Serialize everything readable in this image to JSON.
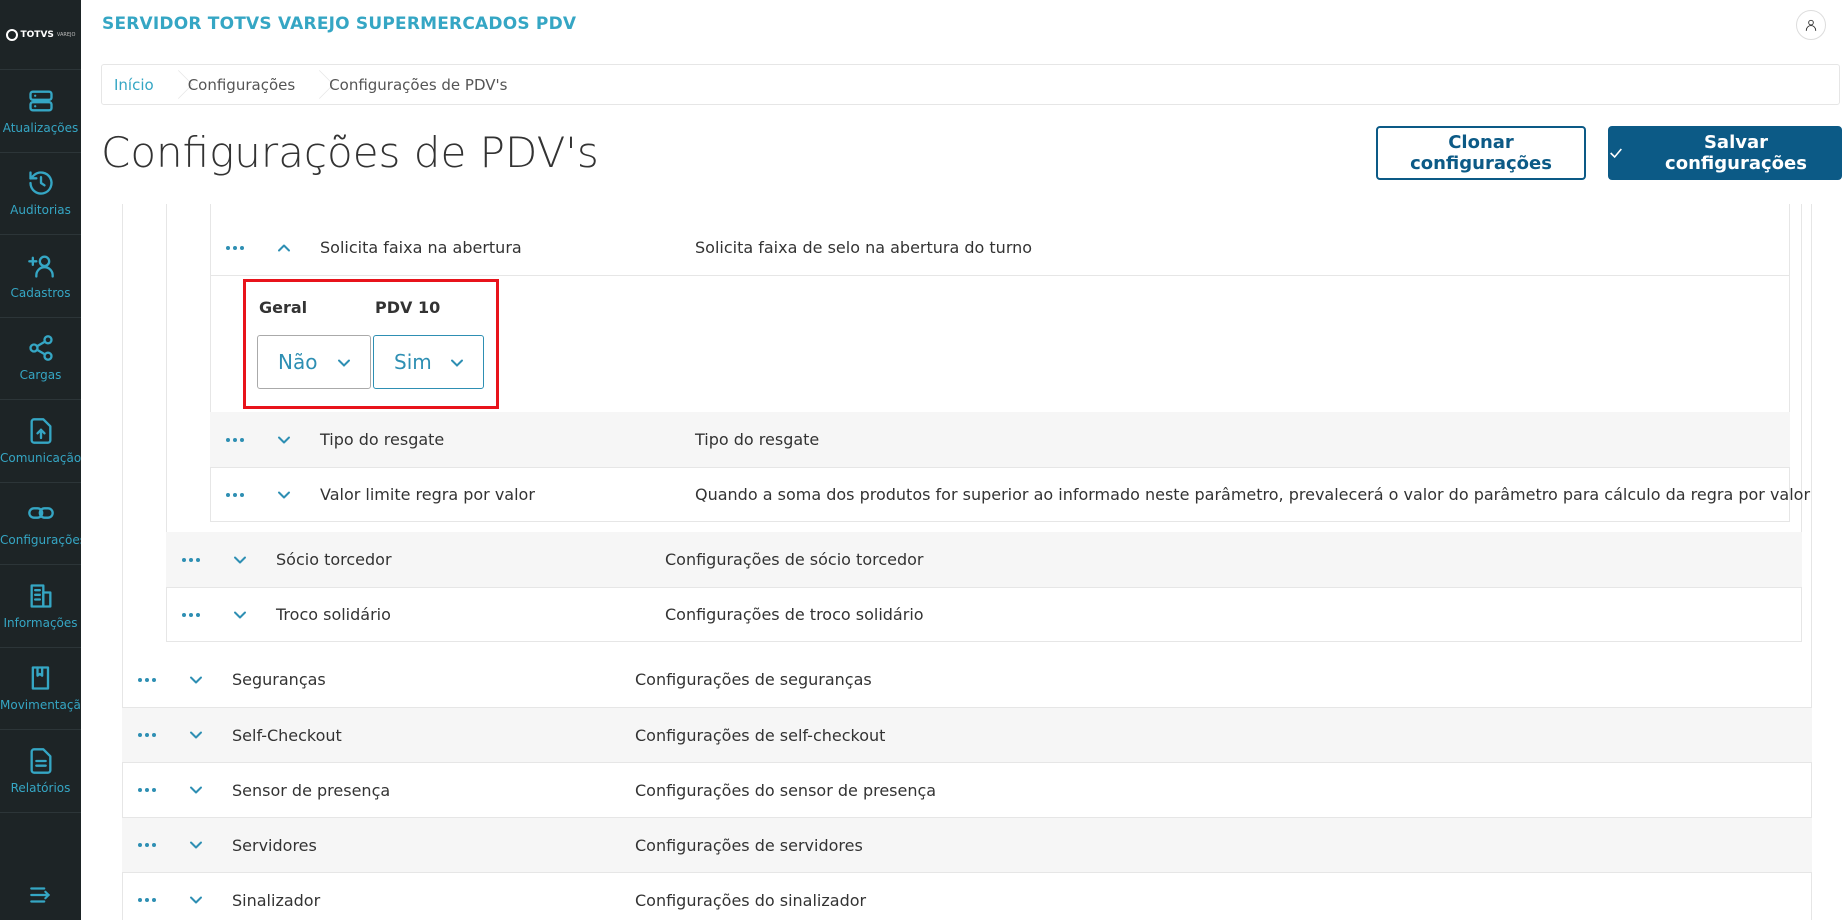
{
  "app": {
    "title": "SERVIDOR TOTVS VAREJO SUPERMERCADOS PDV",
    "logo_text": "TOTVS",
    "logo_sub": "VAREJO"
  },
  "sidebar": {
    "items": [
      {
        "label": "Atualizações",
        "icon": "server-icon"
      },
      {
        "label": "Auditorias",
        "icon": "history-icon"
      },
      {
        "label": "Cadastros",
        "icon": "add-user-icon"
      },
      {
        "label": "Cargas",
        "icon": "share-icon"
      },
      {
        "label": "Comunicação",
        "icon": "file-upload-icon"
      },
      {
        "label": "Configurações",
        "icon": "link-icon"
      },
      {
        "label": "Informações",
        "icon": "building-icon"
      },
      {
        "label": "Movimentação",
        "icon": "book-icon"
      },
      {
        "label": "Relatórios",
        "icon": "document-icon"
      }
    ]
  },
  "breadcrumb": {
    "items": [
      "Início",
      "Configurações",
      "Configurações de PDV's"
    ]
  },
  "page": {
    "title": "Configurações de PDV's",
    "clone_label": "Clonar configurações",
    "save_label": "Salvar configurações"
  },
  "expanded_row": {
    "name": "Solicita faixa na abertura",
    "desc": "Solicita faixa de selo na abertura do turno"
  },
  "detail": {
    "col_general": "Geral",
    "col_pdv": "PDV 10",
    "general_value": "Não",
    "pdv_value": "Sim"
  },
  "level2_rows": [
    {
      "name": "Tipo do resgate",
      "desc": "Tipo do resgate"
    },
    {
      "name": "Valor limite regra por valor",
      "desc": "Quando a soma dos produtos for superior ao informado neste parâmetro, prevalecerá o valor do parâmetro para cálculo da regra por valor"
    }
  ],
  "level1_rows": [
    {
      "name": "Sócio torcedor",
      "desc": "Configurações de sócio torcedor"
    },
    {
      "name": "Troco solidário",
      "desc": "Configurações de troco solidário"
    }
  ],
  "level0_rows": [
    {
      "name": "Seguranças",
      "desc": "Configurações de seguranças"
    },
    {
      "name": "Self-Checkout",
      "desc": "Configurações de self-checkout"
    },
    {
      "name": "Sensor de presença",
      "desc": "Configurações do sensor de presença"
    },
    {
      "name": "Servidores",
      "desc": "Configurações de servidores"
    },
    {
      "name": "Sinalizador",
      "desc": "Configurações do sinalizador"
    }
  ]
}
